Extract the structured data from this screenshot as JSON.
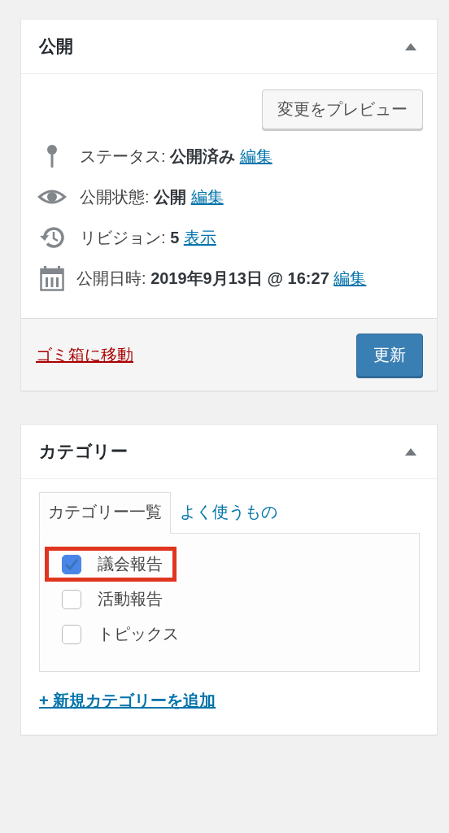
{
  "publish_box": {
    "title": "公開",
    "expanded": true,
    "preview_button": "変更をプレビュー",
    "meta": [
      {
        "kind": "status",
        "label": "ステータス:",
        "value": "公開済み",
        "link": "編集"
      },
      {
        "kind": "visibility",
        "label": "公開状態:",
        "value": "公開",
        "link": "編集"
      },
      {
        "kind": "revisions",
        "label": "リビジョン:",
        "value": "5",
        "link": "表示"
      },
      {
        "kind": "date",
        "label": "公開日時:",
        "value": "2019年9月13日 @ 16:27",
        "link": "編集"
      }
    ],
    "trash_link": "ゴミ箱に移動",
    "update_button": "更新"
  },
  "category_box": {
    "title": "カテゴリー",
    "expanded": true,
    "tabs": [
      {
        "label": "カテゴリー一覧",
        "selected": true
      },
      {
        "label": "よく使うもの",
        "selected": false
      }
    ],
    "items": [
      {
        "label": "議会報告",
        "checked": true,
        "highlighted": true
      },
      {
        "label": "活動報告",
        "checked": false,
        "highlighted": false
      },
      {
        "label": "トピックス",
        "checked": false,
        "highlighted": false
      }
    ],
    "add_link": "+ 新規カテゴリーを追加"
  }
}
